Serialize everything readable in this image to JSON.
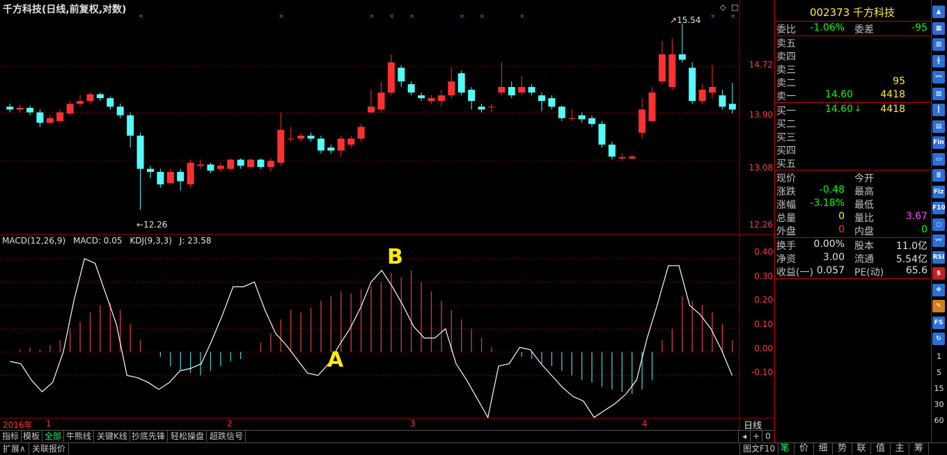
{
  "chart_title": "千方科技(日线,前复权,对数)",
  "price_axis": {
    "labels": [
      "14.72",
      "13.90",
      "13.08",
      "12.26"
    ]
  },
  "price_annotations": {
    "high": "15.54",
    "low": "12.26"
  },
  "indicator_title": {
    "name": "MACD(12,26,9)",
    "macd": "MACD: 0.05",
    "kdj": "KDJ(9,3,3)",
    "j": "J: 23.58"
  },
  "indicator_axis": {
    "labels": [
      "0.40",
      "0.30",
      "0.20",
      "0.10",
      "0.00",
      "-0.10"
    ]
  },
  "annotations": {
    "a": "A",
    "b": "B"
  },
  "time_axis": {
    "year": "2016年",
    "months": [
      "1",
      "2",
      "3",
      "4"
    ],
    "period_label": "日线"
  },
  "tabs": [
    "指标",
    "模板",
    "全部",
    "牛熊线",
    "关键K线",
    "抄底先锋",
    "轻松操盘",
    "超跌信号"
  ],
  "active_tab": "全部",
  "nav": {
    "left": "◂",
    "plus": "+",
    "zero": "0"
  },
  "bottom_tabs": [
    "扩展∧",
    "关联报价"
  ],
  "bottom_right": "图文F10",
  "quote": {
    "code_name": "002373 千方科技",
    "weibi_label": "委比",
    "weibi": "-1.06%",
    "weicha_label": "委差",
    "weicha": "-95",
    "sells": [
      {
        "label": "卖五",
        "price": "",
        "vol": ""
      },
      {
        "label": "卖四",
        "price": "",
        "vol": ""
      },
      {
        "label": "卖三",
        "price": "",
        "vol": ""
      },
      {
        "label": "卖二",
        "price": "",
        "vol": "95"
      },
      {
        "label": "卖一",
        "price": "14.60",
        "vol": "4418"
      }
    ],
    "buys": [
      {
        "label": "买一",
        "price": "14.60",
        "vol": "4418"
      },
      {
        "label": "买二",
        "price": "",
        "vol": ""
      },
      {
        "label": "买三",
        "price": "",
        "vol": ""
      },
      {
        "label": "买四",
        "price": "",
        "vol": ""
      },
      {
        "label": "买五",
        "price": "",
        "vol": ""
      }
    ],
    "buy1_arrow": "↓",
    "stats": [
      {
        "k1": "现价",
        "v1": "",
        "k2": "今开",
        "v2": ""
      },
      {
        "k1": "涨跌",
        "v1": "-0.48",
        "k2": "最高",
        "v2": ""
      },
      {
        "k1": "涨幅",
        "v1": "-3.18%",
        "k2": "最低",
        "v2": ""
      },
      {
        "k1": "总量",
        "v1": "0",
        "k2": "量比",
        "v2": "3.67"
      },
      {
        "k1": "外盘",
        "v1": "0",
        "k2": "内盘",
        "v2": "0"
      }
    ],
    "fund": [
      {
        "k1": "换手",
        "v1": "0.00%",
        "k2": "股本",
        "v2": "11.0亿"
      },
      {
        "k1": "净资",
        "v1": "3.00",
        "k2": "流通",
        "v2": "5.54亿"
      },
      {
        "k1": "收益(一)",
        "v1": "0.057",
        "k2": "PE(动)",
        "v2": "65.6"
      }
    ]
  },
  "right_tabs": [
    "笔",
    "价",
    "细",
    "势",
    "联",
    "值",
    "主",
    "筹"
  ],
  "right_active": "笔",
  "toolbar_icons": [
    {
      "name": "arrow-up-icon",
      "color": "#2a6fd6",
      "glyph": "▲"
    },
    {
      "name": "table-icon",
      "color": "#2a6fd6",
      "glyph": "▦"
    },
    {
      "name": "grid-icon",
      "color": "#2a6fd6",
      "glyph": "▥"
    },
    {
      "name": "kline-icon",
      "color": "#2a6fd6",
      "glyph": "╫"
    },
    {
      "name": "trend-icon",
      "color": "#2a6fd6",
      "glyph": "〰"
    },
    {
      "name": "chart-icon",
      "color": "#2a6fd6",
      "glyph": "▨"
    },
    {
      "name": "vline-icon",
      "color": "#2a6fd6",
      "glyph": "┃"
    },
    {
      "name": "bars-icon",
      "color": "#2a6fd6",
      "glyph": "▤"
    },
    {
      "name": "fin-icon",
      "color": "#2a6fd6",
      "glyph": "Fin"
    },
    {
      "name": "doc-icon",
      "color": "#2a6fd6",
      "glyph": "▭"
    },
    {
      "name": "list-icon",
      "color": "#2a6fd6",
      "glyph": "≣"
    },
    {
      "name": "fiz-icon",
      "color": "#2a6fd6",
      "glyph": "Fiz"
    },
    {
      "name": "f10-icon",
      "color": "#2a6fd6",
      "glyph": "F10"
    },
    {
      "name": "search-icon",
      "color": "#2a6fd6",
      "glyph": "○"
    },
    {
      "name": "wave-icon",
      "color": "#2a6fd6",
      "glyph": "〰"
    },
    {
      "name": "rsi-icon",
      "color": "#2a6fd6",
      "glyph": "RSI"
    },
    {
      "name": "dollar-icon",
      "color": "#c02020",
      "glyph": "$"
    },
    {
      "name": "move-icon",
      "color": "#2a6fd6",
      "glyph": "✥"
    },
    {
      "name": "pencil-icon",
      "color": "#d08020",
      "glyph": "✎"
    },
    {
      "name": "fs-icon",
      "color": "#2a6fd6",
      "glyph": "FS"
    },
    {
      "name": "refresh-icon",
      "color": "#2a6fd6",
      "glyph": "↻"
    }
  ],
  "toolbar_periods": [
    "1",
    "5",
    "15",
    "30",
    "60"
  ],
  "chart_data": {
    "type": "candlestick",
    "price_ylim": [
      12.0,
      15.7
    ],
    "scale": "log",
    "candles": [
      [
        14.0,
        13.95,
        14.05,
        13.9
      ],
      [
        13.95,
        13.98,
        14.03,
        13.9
      ],
      [
        13.98,
        13.9,
        14.02,
        13.85
      ],
      [
        13.9,
        13.72,
        13.95,
        13.65
      ],
      [
        13.72,
        13.8,
        13.85,
        13.7
      ],
      [
        13.75,
        13.9,
        13.95,
        13.72
      ],
      [
        13.88,
        14.05,
        14.1,
        13.85
      ],
      [
        14.05,
        14.1,
        14.2,
        14.0
      ],
      [
        14.1,
        14.22,
        14.25,
        14.05
      ],
      [
        14.22,
        14.15,
        14.25,
        14.1
      ],
      [
        14.15,
        14.0,
        14.18,
        13.95
      ],
      [
        14.0,
        13.85,
        14.05,
        13.8
      ],
      [
        13.85,
        13.5,
        13.9,
        13.3
      ],
      [
        13.5,
        12.95,
        13.55,
        12.3
      ],
      [
        12.95,
        12.9,
        13.0,
        12.8
      ],
      [
        12.9,
        12.7,
        12.95,
        12.65
      ],
      [
        12.72,
        12.9,
        12.95,
        12.7
      ],
      [
        12.9,
        12.75,
        12.95,
        12.6
      ],
      [
        12.7,
        13.05,
        13.1,
        12.65
      ],
      [
        13.0,
        13.02,
        13.1,
        12.95
      ],
      [
        13.02,
        12.92,
        13.05,
        12.88
      ],
      [
        12.95,
        13.0,
        13.05,
        12.9
      ],
      [
        12.95,
        13.1,
        13.12,
        12.92
      ],
      [
        13.1,
        13.0,
        13.12,
        12.95
      ],
      [
        12.98,
        13.1,
        13.12,
        12.95
      ],
      [
        13.1,
        12.98,
        13.12,
        12.95
      ],
      [
        12.98,
        13.08,
        13.12,
        12.9
      ],
      [
        13.05,
        13.6,
        13.9,
        13.0
      ],
      [
        13.45,
        13.45,
        13.65,
        13.4
      ],
      [
        13.45,
        13.5,
        13.55,
        13.4
      ],
      [
        13.5,
        13.45,
        13.55,
        13.4
      ],
      [
        13.45,
        13.25,
        13.5,
        13.2
      ],
      [
        13.3,
        13.25,
        13.35,
        13.2
      ],
      [
        13.25,
        13.45,
        13.5,
        13.15
      ],
      [
        13.35,
        13.45,
        13.5,
        13.3
      ],
      [
        13.45,
        13.65,
        13.7,
        13.4
      ],
      [
        13.9,
        14.0,
        14.3,
        13.88
      ],
      [
        13.95,
        14.25,
        14.45,
        13.9
      ],
      [
        14.25,
        14.8,
        14.95,
        14.2
      ],
      [
        14.7,
        14.45,
        14.75,
        14.35
      ],
      [
        14.4,
        14.25,
        14.45,
        14.2
      ],
      [
        14.2,
        14.15,
        14.25,
        14.1
      ],
      [
        14.1,
        14.15,
        14.2,
        14.05
      ],
      [
        14.1,
        14.2,
        14.3,
        14.0
      ],
      [
        14.2,
        14.45,
        14.7,
        14.15
      ],
      [
        14.6,
        14.25,
        14.65,
        14.2
      ],
      [
        14.3,
        14.1,
        14.35,
        13.95
      ],
      [
        14.0,
        13.95,
        14.05,
        13.9
      ],
      [
        14.0,
        14.0,
        14.05,
        13.9
      ],
      [
        14.25,
        14.35,
        14.8,
        14.2
      ],
      [
        14.35,
        14.2,
        14.45,
        14.15
      ],
      [
        14.25,
        14.35,
        14.55,
        14.2
      ],
      [
        14.35,
        14.25,
        14.4,
        14.2
      ],
      [
        14.2,
        14.1,
        14.25,
        13.92
      ],
      [
        14.15,
        14.0,
        14.2,
        13.95
      ],
      [
        14.0,
        13.8,
        14.02,
        13.75
      ],
      [
        13.8,
        13.8,
        13.95,
        13.75
      ],
      [
        13.85,
        13.78,
        13.9,
        13.72
      ],
      [
        13.8,
        13.7,
        13.85,
        13.65
      ],
      [
        13.7,
        13.35,
        13.75,
        13.3
      ],
      [
        13.35,
        13.15,
        13.4,
        13.1
      ],
      [
        13.12,
        13.14,
        13.2,
        13.08
      ],
      [
        13.12,
        13.15,
        13.18,
        13.1
      ],
      [
        13.55,
        13.95,
        14.15,
        13.45
      ],
      [
        13.75,
        14.25,
        14.35,
        13.75
      ],
      [
        14.45,
        14.95,
        15.2,
        14.4
      ],
      [
        14.35,
        14.95,
        15.25,
        14.3
      ],
      [
        14.95,
        14.85,
        15.54,
        14.8
      ],
      [
        14.7,
        14.1,
        14.8,
        14.05
      ],
      [
        14.1,
        14.3,
        14.4,
        14.05
      ],
      [
        14.25,
        14.35,
        14.75,
        14.15
      ],
      [
        14.2,
        14.0,
        14.3,
        13.95
      ],
      [
        14.05,
        13.95,
        14.42,
        13.88
      ]
    ],
    "macd_ylim": [
      -0.28,
      0.45
    ],
    "macd_hist": [
      0.0,
      0.01,
      0.02,
      0.01,
      0.03,
      0.05,
      0.1,
      0.13,
      0.17,
      0.2,
      0.21,
      0.18,
      0.12,
      0.05,
      0.0,
      -0.02,
      -0.06,
      -0.08,
      -0.09,
      -0.1,
      -0.08,
      -0.06,
      -0.04,
      -0.03,
      0.0,
      0.04,
      0.08,
      0.14,
      0.18,
      0.17,
      0.19,
      0.22,
      0.24,
      0.26,
      0.25,
      0.27,
      0.28,
      0.3,
      0.34,
      0.32,
      0.35,
      0.3,
      0.26,
      0.22,
      0.18,
      0.14,
      0.1,
      0.06,
      0.02,
      -0.0,
      0.0,
      -0.02,
      -0.03,
      -0.05,
      -0.06,
      -0.08,
      -0.1,
      -0.12,
      -0.13,
      -0.15,
      -0.16,
      -0.17,
      -0.18,
      -0.16,
      -0.12,
      0.05,
      0.1,
      0.24,
      0.22,
      0.2,
      0.17,
      0.12,
      0.05
    ],
    "kdj_j": [
      -0.04,
      -0.05,
      -0.12,
      -0.17,
      -0.13,
      0.0,
      0.22,
      0.4,
      0.38,
      0.25,
      0.12,
      -0.1,
      -0.11,
      -0.13,
      -0.16,
      -0.13,
      -0.08,
      -0.07,
      -0.05,
      0.05,
      0.16,
      0.28,
      0.28,
      0.3,
      0.18,
      0.08,
      0.03,
      -0.03,
      -0.09,
      -0.1,
      -0.05,
      0.03,
      0.1,
      0.19,
      0.3,
      0.35,
      0.28,
      0.2,
      0.11,
      0.06,
      0.06,
      0.1,
      -0.05,
      -0.12,
      -0.2,
      -0.28,
      -0.06,
      -0.05,
      0.02,
      0.01,
      -0.05,
      -0.1,
      -0.15,
      -0.19,
      -0.21,
      -0.28,
      -0.25,
      -0.22,
      -0.18,
      -0.12,
      0.06,
      0.21,
      0.37,
      0.37,
      0.2,
      0.16,
      0.1,
      0.01,
      -0.1
    ]
  }
}
